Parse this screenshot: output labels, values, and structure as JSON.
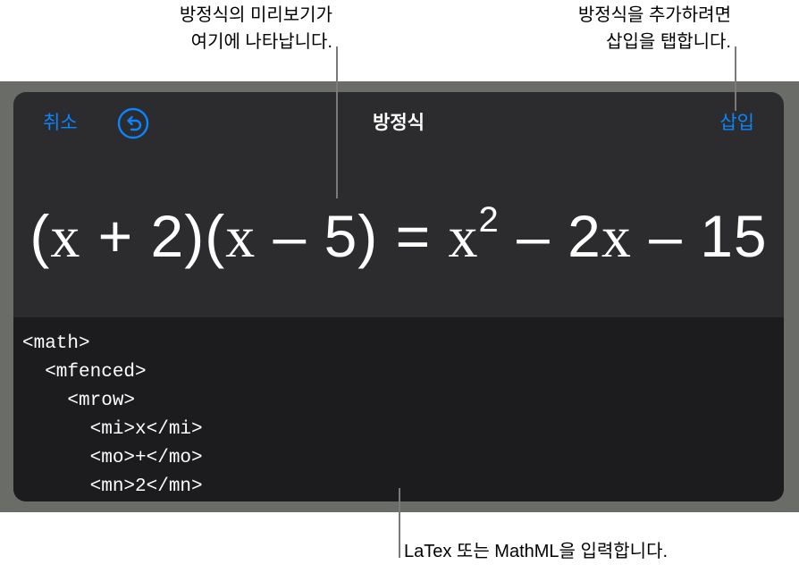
{
  "callouts": {
    "preview_line1": "방정식의 미리보기가",
    "preview_line2": "여기에 나타납니다.",
    "insert_line1": "방정식을 추가하려면",
    "insert_line2": "삽입을 탭합니다.",
    "input_hint": "LaTex 또는 MathML을 입력합니다."
  },
  "toolbar": {
    "cancel_label": "취소",
    "undo_icon": "undo-arrow-icon",
    "title": "방정식",
    "insert_label": "삽입"
  },
  "preview": {
    "open1": "(",
    "x1": "x",
    "plus2": " + 2)(",
    "x2": "x",
    "minus5": " – 5) = ",
    "x3": "x",
    "exp": "2",
    "minus2": " – 2",
    "x4": "x",
    "minus15": " – 15"
  },
  "editor": {
    "lines": [
      "<math>",
      "  <mfenced>",
      "    <mrow>",
      "      <mi>x</mi>",
      "      <mo>+</mo>",
      "      <mn>2</mn>"
    ]
  },
  "colors": {
    "accent": "#0a84ff",
    "dialog_bg": "#2c2c2e",
    "editor_bg": "#1c1c1e",
    "frame_bg": "#6a6c67"
  }
}
